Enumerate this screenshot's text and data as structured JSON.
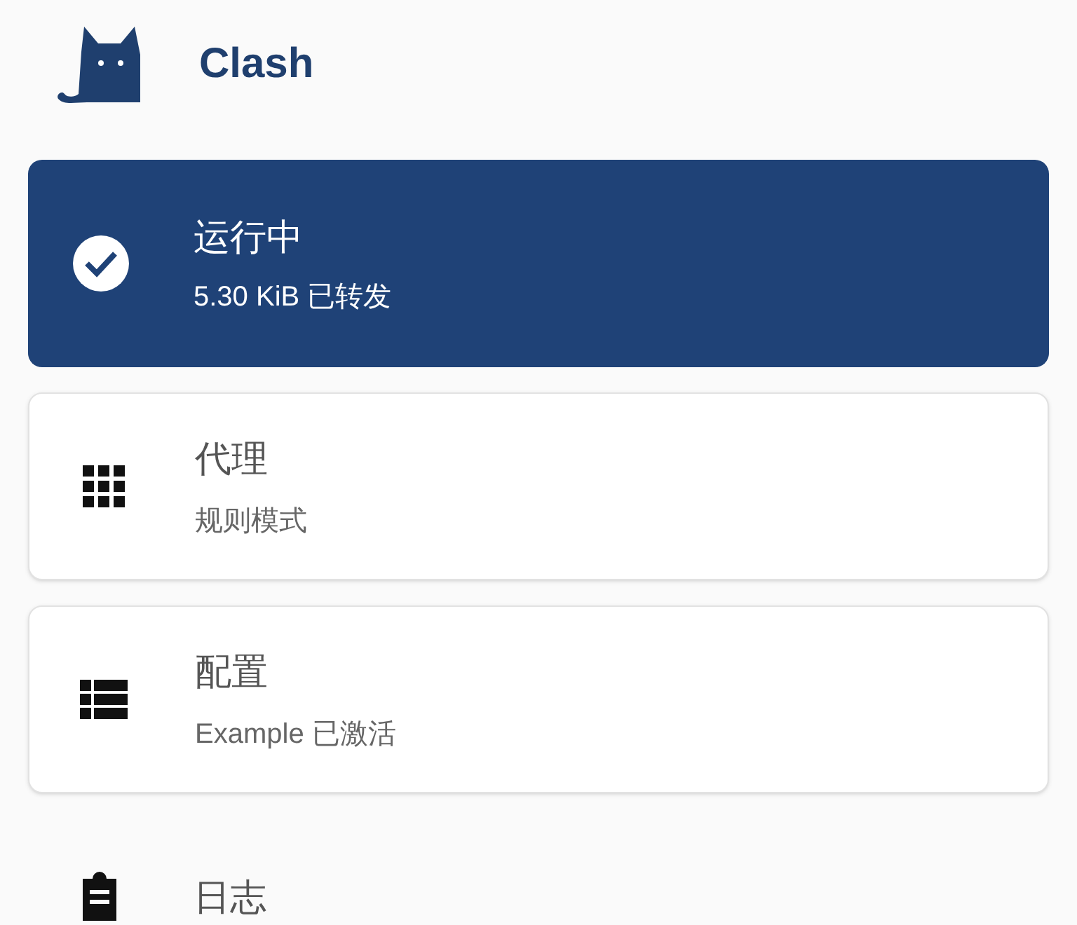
{
  "app": {
    "title": "Clash"
  },
  "status": {
    "title": "运行中",
    "detail": "5.30 KiB 已转发",
    "running": true
  },
  "items": [
    {
      "kind": "grid",
      "title": "代理",
      "subtitle": "规则模式"
    },
    {
      "kind": "list",
      "title": "配置",
      "subtitle": "Example 已激活"
    }
  ],
  "log": {
    "kind": "clipboard",
    "title": "日志"
  }
}
